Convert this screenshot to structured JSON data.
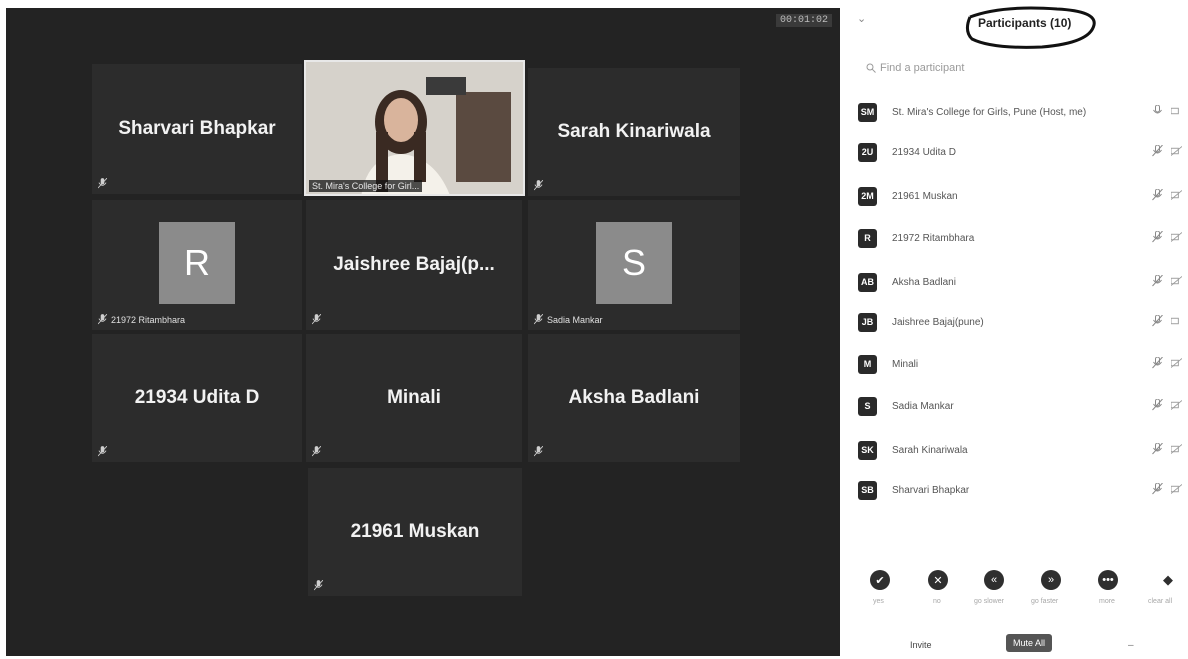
{
  "meeting": {
    "timer": "00:01:02"
  },
  "tiles": [
    {
      "name": "Sharvari Bhapkar",
      "mic_label": ""
    },
    {
      "name": "Sarah Kinariwala",
      "mic_label": ""
    },
    {
      "name": "Jaishree  Bajaj(p...",
      "mic_label": ""
    },
    {
      "name": "21934 Udita D",
      "mic_label": ""
    },
    {
      "name": "Minali",
      "mic_label": ""
    },
    {
      "name": "Aksha Badlani",
      "mic_label": ""
    },
    {
      "name": "21961 Muskan",
      "mic_label": ""
    }
  ],
  "avatar_tiles": [
    {
      "initial": "R",
      "mic_label": "21972 Ritambhara"
    },
    {
      "initial": "S",
      "mic_label": "Sadia Mankar"
    }
  ],
  "host_tile": {
    "label": "St. Mira's College for Girl..."
  },
  "panel": {
    "title": "Participants (10)",
    "search_placeholder": "Find a participant",
    "participants": [
      {
        "initials": "SM",
        "name": "St. Mira's College for Girls, Pune (Host, me)"
      },
      {
        "initials": "2U",
        "name": "21934 Udita D"
      },
      {
        "initials": "2M",
        "name": "21961 Muskan"
      },
      {
        "initials": "R",
        "name": "21972 Ritambhara"
      },
      {
        "initials": "AB",
        "name": "Aksha Badlani"
      },
      {
        "initials": "JB",
        "name": "Jaishree Bajaj(pune)"
      },
      {
        "initials": "M",
        "name": "Minali"
      },
      {
        "initials": "S",
        "name": "Sadia Mankar"
      },
      {
        "initials": "SK",
        "name": "Sarah Kinariwala"
      },
      {
        "initials": "SB",
        "name": "Sharvari Bhapkar"
      }
    ],
    "reactions": [
      {
        "icon": "check-icon",
        "label": "yes"
      },
      {
        "icon": "x-icon",
        "label": "no"
      },
      {
        "icon": "rewind-icon",
        "label": "go slower"
      },
      {
        "icon": "fast-forward-icon",
        "label": "go faster"
      },
      {
        "icon": "more-icon",
        "label": "more"
      },
      {
        "icon": "diamond-icon",
        "label": "clear all"
      }
    ],
    "invite_label": "Invite",
    "mute_all_label": "Mute All"
  }
}
